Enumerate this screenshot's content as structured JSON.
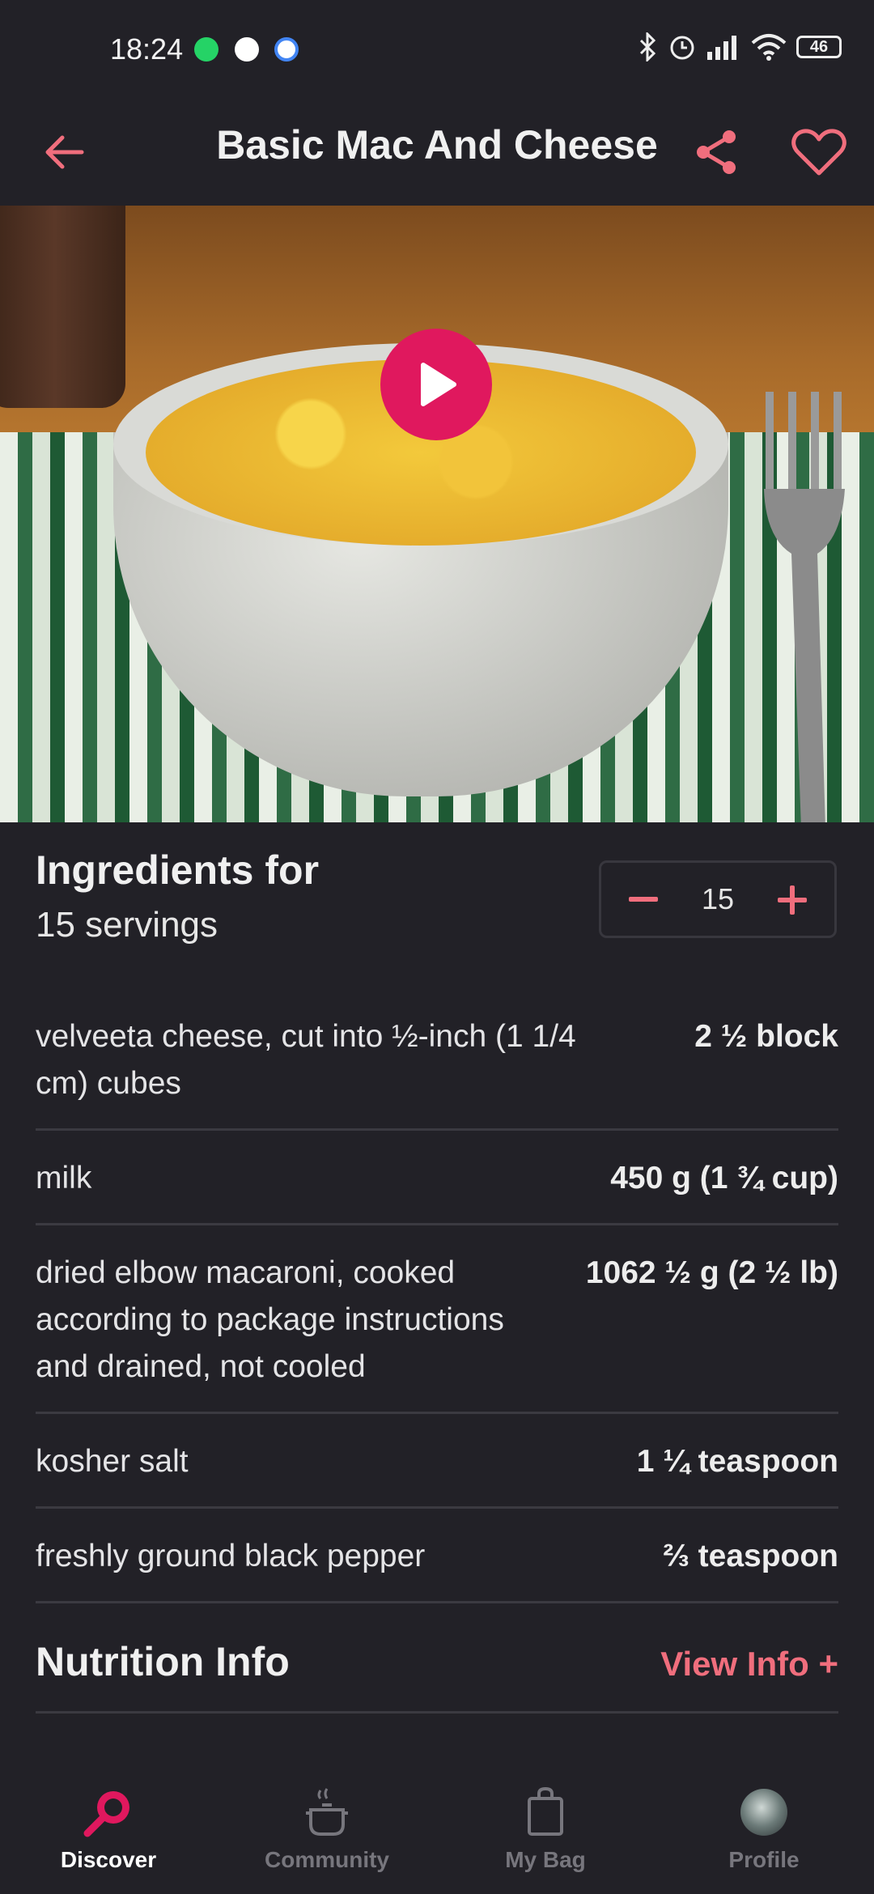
{
  "status": {
    "time": "18:24",
    "battery": "46"
  },
  "appbar": {
    "title": "Basic Mac And Cheese"
  },
  "ingredients": {
    "title": "Ingredients for",
    "servings_text": "15 servings",
    "stepper_value": "15",
    "items": [
      {
        "name": "velveeta cheese, cut into ½-inch (1 1/4 cm) cubes",
        "qty": "2 ½ block"
      },
      {
        "name": "milk",
        "qty": "450 g (1 ¾ cup)"
      },
      {
        "name": "dried elbow macaroni, cooked according to package instructions and drained, not cooled",
        "qty": "1062 ½ g (2 ½ lb)"
      },
      {
        "name": "kosher salt",
        "qty": "1 ¼ teaspoon"
      },
      {
        "name": "freshly ground black pepper",
        "qty": "⅔ teaspoon"
      }
    ]
  },
  "nutrition": {
    "title": "Nutrition Info",
    "link": "View Info +"
  },
  "nav": {
    "items": [
      {
        "label": "Discover",
        "icon": "search-icon",
        "active": true
      },
      {
        "label": "Community",
        "icon": "pot-icon",
        "active": false
      },
      {
        "label": "My Bag",
        "icon": "bag-icon",
        "active": false
      },
      {
        "label": "Profile",
        "icon": "avatar",
        "active": false
      }
    ]
  },
  "colors": {
    "accent": "#E0185E",
    "accent_light": "#F06E7D",
    "background": "#222127"
  }
}
